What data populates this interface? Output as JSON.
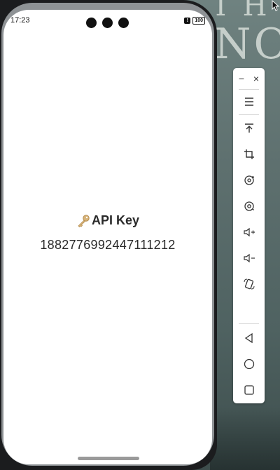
{
  "statusbar": {
    "time": "17:23",
    "battery": "100"
  },
  "app": {
    "title": "API Key",
    "key_icon": "key-icon",
    "api_key_value": "1882776992447111212"
  },
  "wallpaper": {
    "line1": "TH",
    "line2": "NO"
  },
  "toolbar": {
    "minimize": "−",
    "close": "×",
    "items": [
      {
        "name": "menu-icon"
      },
      {
        "name": "pin-top-icon"
      },
      {
        "name": "crop-icon"
      },
      {
        "name": "rotate-icon"
      },
      {
        "name": "screenshot-icon"
      },
      {
        "name": "volume-up-icon"
      },
      {
        "name": "volume-down-icon"
      },
      {
        "name": "rotate-device-icon"
      },
      {
        "name": "back-icon"
      },
      {
        "name": "home-icon"
      },
      {
        "name": "recents-icon"
      }
    ]
  },
  "colors": {
    "text": "#2a2a2a",
    "key_gold": "#d8b47a"
  }
}
